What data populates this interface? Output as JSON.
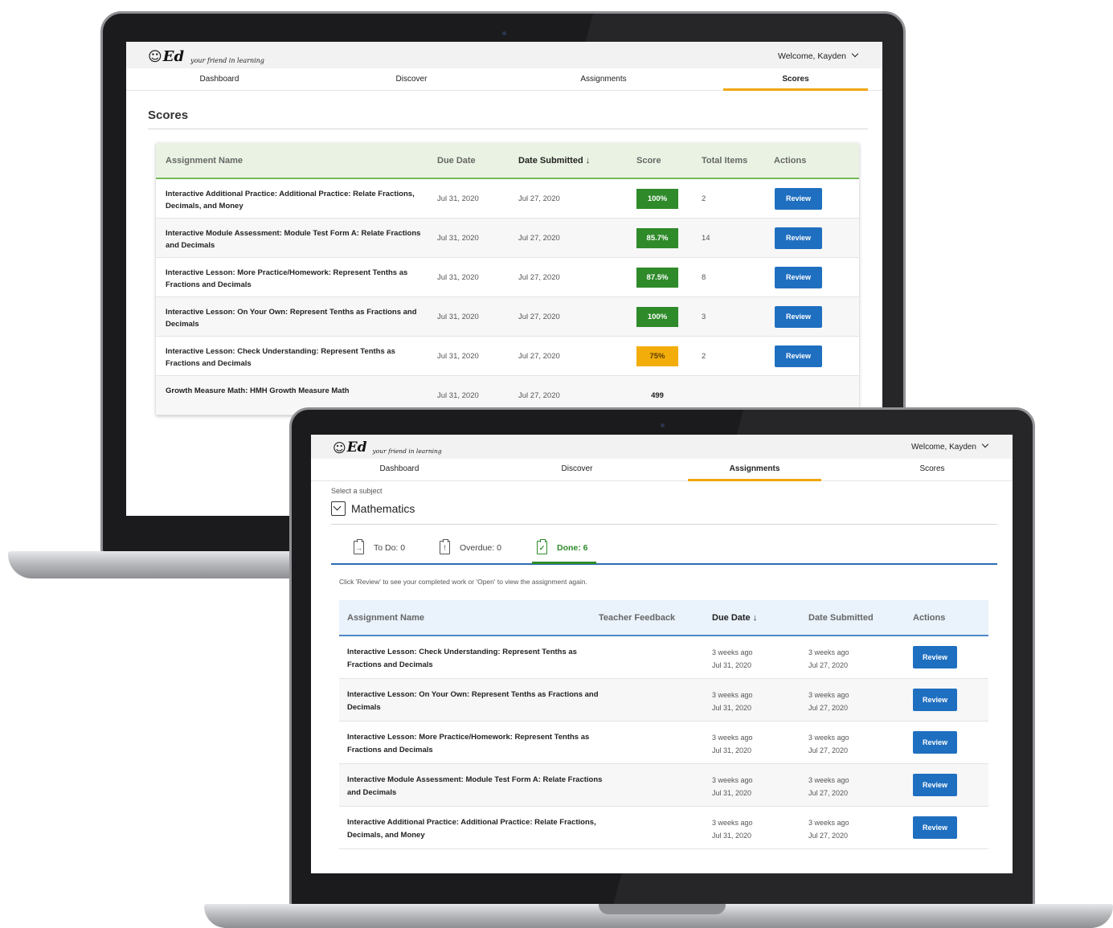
{
  "back_screen": {
    "logo": {
      "face": "☺",
      "mark": "Ed",
      "tagline": "your friend in learning"
    },
    "welcome": "Welcome, Kayden",
    "nav": [
      "Dashboard",
      "Discover",
      "Assignments",
      "Scores"
    ],
    "active_nav": "Scores",
    "page_title": "Scores",
    "table": {
      "headers": {
        "name": "Assignment Name",
        "due": "Due Date",
        "submitted": "Date Submitted ↓",
        "score": "Score",
        "items": "Total Items",
        "actions": "Actions"
      },
      "rows": [
        {
          "name": "Interactive Additional Practice: Additional Practice: Relate Fractions, Decimals, and Money",
          "due": "Jul 31, 2020",
          "submitted": "Jul 27, 2020",
          "score": "100%",
          "score_status": "green",
          "items": "2",
          "action": "Review"
        },
        {
          "name": "Interactive Module Assessment: Module Test Form A: Relate Fractions and Decimals",
          "due": "Jul 31, 2020",
          "submitted": "Jul 27, 2020",
          "score": "85.7%",
          "score_status": "green",
          "items": "14",
          "action": "Review"
        },
        {
          "name": "Interactive Lesson: More Practice/Homework: Represent Tenths as Fractions and Decimals",
          "due": "Jul 31, 2020",
          "submitted": "Jul 27, 2020",
          "score": "87.5%",
          "score_status": "green",
          "items": "8",
          "action": "Review"
        },
        {
          "name": "Interactive Lesson: On Your Own: Represent Tenths as Fractions and Decimals",
          "due": "Jul 31, 2020",
          "submitted": "Jul 27, 2020",
          "score": "100%",
          "score_status": "green",
          "items": "3",
          "action": "Review"
        },
        {
          "name": "Interactive Lesson: Check Understanding: Represent Tenths as Fractions and Decimals",
          "due": "Jul 31, 2020",
          "submitted": "Jul 27, 2020",
          "score": "75%",
          "score_status": "amber",
          "items": "2",
          "action": "Review"
        },
        {
          "name": "Growth Measure Math: HMH Growth Measure Math",
          "due": "Jul 31, 2020",
          "submitted": "Jul 27, 2020",
          "score": "499",
          "score_status": "plain",
          "items": "",
          "action": ""
        }
      ]
    }
  },
  "front_screen": {
    "logo": {
      "face": "☺",
      "mark": "Ed",
      "tagline": "your friend in learning"
    },
    "welcome": "Welcome, Kayden",
    "nav": [
      "Dashboard",
      "Discover",
      "Assignments",
      "Scores"
    ],
    "active_nav": "Assignments",
    "subject_label": "Select a subject",
    "subject": "Mathematics",
    "tabs": [
      {
        "label": "To Do: 0",
        "icon": "→"
      },
      {
        "label": "Overdue: 0",
        "icon": "!"
      },
      {
        "label": "Done: 6",
        "icon": "✓"
      }
    ],
    "hint": "Click 'Review' to see your completed work or 'Open' to view the assignment again.",
    "table": {
      "headers": {
        "name": "Assignment Name",
        "feedback": "Teacher Feedback",
        "due": "Due Date ↓",
        "submitted": "Date Submitted",
        "actions": "Actions"
      },
      "rows": [
        {
          "name": "Interactive Lesson: Check Understanding: Represent Tenths as Fractions and Decimals",
          "due_rel": "3 weeks ago",
          "due": "Jul 31, 2020",
          "sub_rel": "3 weeks ago",
          "submitted": "Jul 27, 2020",
          "action": "Review"
        },
        {
          "name": "Interactive Lesson: On Your Own: Represent Tenths as Fractions and Decimals",
          "due_rel": "3 weeks ago",
          "due": "Jul 31, 2020",
          "sub_rel": "3 weeks ago",
          "submitted": "Jul 27, 2020",
          "action": "Review"
        },
        {
          "name": "Interactive Lesson: More Practice/Homework: Represent Tenths as Fractions and Decimals",
          "due_rel": "3 weeks ago",
          "due": "Jul 31, 2020",
          "sub_rel": "3 weeks ago",
          "submitted": "Jul 27, 2020",
          "action": "Review"
        },
        {
          "name": "Interactive Module Assessment: Module Test Form A: Relate Fractions and Decimals",
          "due_rel": "3 weeks ago",
          "due": "Jul 31, 2020",
          "sub_rel": "3 weeks ago",
          "submitted": "Jul 27, 2020",
          "action": "Review"
        },
        {
          "name": "Interactive Additional Practice: Additional Practice: Relate Fractions, Decimals, and Money",
          "due_rel": "3 weeks ago",
          "due": "Jul 31, 2020",
          "sub_rel": "3 weeks ago",
          "submitted": "Jul 27, 2020",
          "action": "Review"
        }
      ]
    }
  },
  "colors": {
    "nav_underline": "#f0a60d",
    "score_green": "#2f8a2a",
    "score_amber": "#f2ad0a",
    "review_button": "#1f6fc0",
    "done_tab": "#2e8c2a"
  }
}
